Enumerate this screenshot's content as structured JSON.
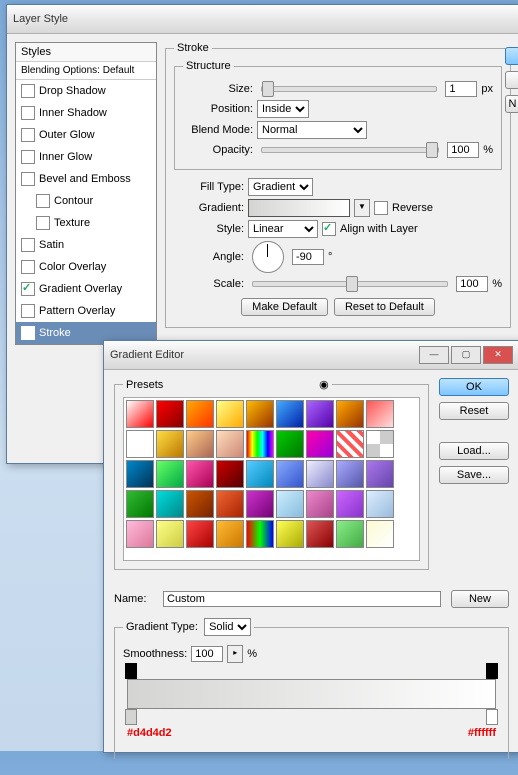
{
  "layerStyle": {
    "title": "Layer Style",
    "stylesHeader": "Styles",
    "blendingOptions": "Blending Options: Default",
    "items": [
      {
        "label": "Drop Shadow",
        "checked": false,
        "indent": false
      },
      {
        "label": "Inner Shadow",
        "checked": false,
        "indent": false
      },
      {
        "label": "Outer Glow",
        "checked": false,
        "indent": false
      },
      {
        "label": "Inner Glow",
        "checked": false,
        "indent": false
      },
      {
        "label": "Bevel and Emboss",
        "checked": false,
        "indent": false
      },
      {
        "label": "Contour",
        "checked": false,
        "indent": true
      },
      {
        "label": "Texture",
        "checked": false,
        "indent": true
      },
      {
        "label": "Satin",
        "checked": false,
        "indent": false
      },
      {
        "label": "Color Overlay",
        "checked": false,
        "indent": false
      },
      {
        "label": "Gradient Overlay",
        "checked": true,
        "indent": false
      },
      {
        "label": "Pattern Overlay",
        "checked": false,
        "indent": false
      },
      {
        "label": "Stroke",
        "checked": true,
        "indent": false,
        "selected": true
      }
    ],
    "stroke": {
      "fieldset": "Stroke",
      "structure": "Structure",
      "sizeLabel": "Size:",
      "sizeValue": "1",
      "sizeUnit": "px",
      "positionLabel": "Position:",
      "positionValue": "Inside",
      "blendLabel": "Blend Mode:",
      "blendValue": "Normal",
      "opacityLabel": "Opacity:",
      "opacityValue": "100",
      "opacityUnit": "%",
      "fillTypeLabel": "Fill Type:",
      "fillTypeValue": "Gradient",
      "gradientLabel": "Gradient:",
      "reverseLabel": "Reverse",
      "styleLabel": "Style:",
      "styleValue": "Linear",
      "alignLabel": "Align with Layer",
      "angleLabel": "Angle:",
      "angleValue": "-90",
      "angleUnit": "°",
      "scaleLabel": "Scale:",
      "scaleValue": "100",
      "scaleUnit": "%",
      "makeDefault": "Make Default",
      "resetDefault": "Reset to Default"
    },
    "rightBtns": {
      "ok": "",
      "cancel": "",
      "new": "N"
    }
  },
  "gradientEditor": {
    "title": "Gradient Editor",
    "presets": "Presets",
    "ok": "OK",
    "reset": "Reset",
    "load": "Load...",
    "save": "Save...",
    "nameLabel": "Name:",
    "nameValue": "Custom",
    "new": "New",
    "gradTypeLabel": "Gradient Type:",
    "gradTypeValue": "Solid",
    "smoothLabel": "Smoothness:",
    "smoothValue": "100",
    "smoothUnit": "%",
    "hex1": "#d4d4d2",
    "hex2": "#ffffff",
    "presetColors": [
      "linear-gradient(135deg,#fff,#f00)",
      "linear-gradient(135deg,#f00,#800)",
      "linear-gradient(135deg,#fa0,#f30)",
      "linear-gradient(135deg,#ff8,#fa0)",
      "linear-gradient(135deg,#fb0,#930)",
      "linear-gradient(135deg,#4af,#02a)",
      "linear-gradient(135deg,#a6f,#50a)",
      "linear-gradient(135deg,#fa0,#930)",
      "linear-gradient(135deg,#f55,#fdd)",
      "linear-gradient(180deg,#fff,#fff)",
      "linear-gradient(135deg,#fd4,#b70)",
      "linear-gradient(135deg,#fc8,#a65)",
      "linear-gradient(135deg,#fdb,#c87)",
      "linear-gradient(90deg,#f00,#ff0,#0f0,#0ff,#00f,#f0f)",
      "linear-gradient(135deg,#0c0,#070)",
      "linear-gradient(135deg,#f0a,#90d)",
      "repeating-linear-gradient(45deg,#f55 0 4px,#fff 4px 8px)",
      "repeating-conic-gradient(#ccc 0 25%,#fff 0 50%)",
      "linear-gradient(135deg,#08c,#035)",
      "linear-gradient(135deg,#6f6,#0a4)",
      "linear-gradient(135deg,#f5a,#a05)",
      "linear-gradient(135deg,#c00,#500)",
      "linear-gradient(135deg,#5cf,#08b)",
      "linear-gradient(135deg,#8af,#35c)",
      "linear-gradient(135deg,#eef,#88c)",
      "linear-gradient(135deg,#aaf,#55a)",
      "linear-gradient(135deg,#a7e,#64a)",
      "linear-gradient(135deg,#3b3,#070)",
      "linear-gradient(135deg,#0dd,#088)",
      "linear-gradient(135deg,#c50,#720)",
      "linear-gradient(135deg,#e63,#a20)",
      "linear-gradient(135deg,#c3c,#707)",
      "linear-gradient(135deg,#cef,#8bd)",
      "linear-gradient(135deg,#e8c,#a48)",
      "linear-gradient(135deg,#c6f,#83c)",
      "linear-gradient(135deg,#def,#9bd)",
      "linear-gradient(135deg,#fbd,#d79)",
      "linear-gradient(135deg,#ff8,#cc4)",
      "linear-gradient(135deg,#f44,#a00)",
      "linear-gradient(135deg,#fb3,#c70)",
      "linear-gradient(90deg,#f00,#0f0,#00f)",
      "linear-gradient(135deg,#ff5,#aa0)",
      "linear-gradient(135deg,#d55,#800)",
      "linear-gradient(135deg,#8e8,#4a4)",
      "linear-gradient(135deg,#fafad2,#fff)"
    ]
  }
}
